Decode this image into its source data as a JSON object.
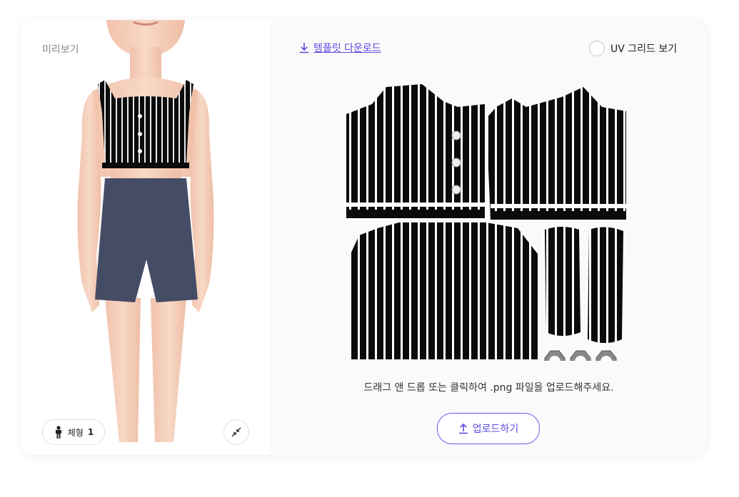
{
  "preview": {
    "label": "미리보기",
    "body_type_label": "체형",
    "body_type_value": "1"
  },
  "toolbar": {
    "download_label": "템플릿 다운로드",
    "uv_grid_label": "UV 그리드 보기"
  },
  "upload": {
    "hint": "드래그 앤 드롭 또는 클릭하여 .png 파일을 업로드해주세요.",
    "button_label": "업로드하기"
  },
  "colors": {
    "accent": "#5b4be0",
    "shorts": "#454c66",
    "skin": "#f3cbb6",
    "stripe_dark": "#0b0b0b"
  },
  "icons": [
    "download-icon",
    "radio-icon",
    "person-icon",
    "collapse-icon",
    "upload-icon"
  ]
}
